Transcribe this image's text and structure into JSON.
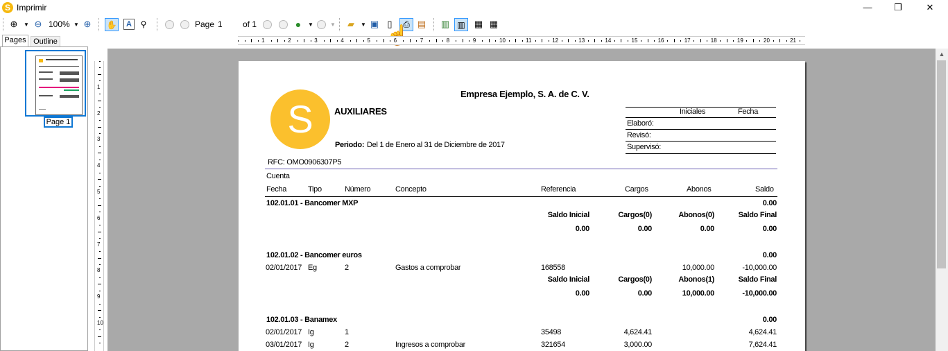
{
  "window": {
    "title": "Imprimir",
    "controls": {
      "minimize": "—",
      "restore": "❐",
      "close": "✕"
    }
  },
  "toolbar": {
    "zoom_value": "100%",
    "page_label": "Page",
    "page_number": "1",
    "of_label": "of 1"
  },
  "tabs": {
    "pages": "Pages",
    "outline": "Outline"
  },
  "thumbnail": {
    "label": "Page 1"
  },
  "ruler": {
    "h_labels": [
      "1",
      "2",
      "3",
      "4",
      "5",
      "6",
      "7",
      "8",
      "9",
      "10",
      "11",
      "12",
      "13",
      "14",
      "15",
      "16",
      "17",
      "18",
      "19",
      "20",
      "21"
    ],
    "v_labels": [
      "1",
      "2",
      "3",
      "4",
      "5",
      "6",
      "7",
      "8",
      "9",
      "10"
    ]
  },
  "report": {
    "company": "Empresa Ejemplo, S. A. de C. V.",
    "logo_letter": "S",
    "logo_color": "#fbc02d",
    "title": "AUXILIARES",
    "period_label": "Periodo:",
    "period_value": "Del 1 de Enero al 31 de Diciembre de 2017",
    "rfc": "RFC: OMO0906307P5",
    "signatures": {
      "initials_header": "Iniciales",
      "date_header": "Fecha",
      "rows": [
        "Elaboró:",
        "Revisó:",
        "Supervisó:"
      ]
    },
    "columns": {
      "cuenta": "Cuenta",
      "fecha": "Fecha",
      "tipo": "Tipo",
      "numero": "Número",
      "concepto": "Concepto",
      "referencia": "Referencia",
      "cargos": "Cargos",
      "abonos": "Abonos",
      "saldo": "Saldo"
    },
    "summary_headers": {
      "saldo_inicial": "Saldo Inicial",
      "cargos": "Cargos(0)",
      "abonos": "Abonos(0)",
      "saldo_final": "Saldo Final"
    },
    "accounts": [
      {
        "title": "102.01.01 - Bancomer MXP",
        "balance": "0.00",
        "summary": {
          "h_saldo_inicial": "Saldo Inicial",
          "h_cargos": "Cargos(0)",
          "h_abonos": "Abonos(0)",
          "h_saldo_final": "Saldo Final",
          "saldo_inicial": "0.00",
          "cargos": "0.00",
          "abonos": "0.00",
          "saldo_final": "0.00"
        }
      },
      {
        "title": "102.01.02 - Bancomer euros",
        "balance": "0.00",
        "rows": [
          {
            "fecha": "02/01/2017",
            "tipo": "Eg",
            "numero": "2",
            "concepto": "Gastos a comprobar",
            "referencia": "168558",
            "cargos": "",
            "abonos": "10,000.00",
            "saldo": "-10,000.00"
          }
        ],
        "summary": {
          "h_saldo_inicial": "Saldo Inicial",
          "h_cargos": "Cargos(0)",
          "h_abonos": "Abonos(1)",
          "h_saldo_final": "Saldo Final",
          "saldo_inicial": "0.00",
          "cargos": "0.00",
          "abonos": "10,000.00",
          "saldo_final": "-10,000.00"
        }
      },
      {
        "title": "102.01.03 - Banamex",
        "balance": "0.00",
        "rows": [
          {
            "fecha": "02/01/2017",
            "tipo": "Ig",
            "numero": "1",
            "concepto": "",
            "referencia": "35498",
            "cargos": "4,624.41",
            "abonos": "",
            "saldo": "4,624.41"
          },
          {
            "fecha": "03/01/2017",
            "tipo": "Ig",
            "numero": "2",
            "concepto": "Ingresos a comprobar",
            "referencia": "321654",
            "cargos": "3,000.00",
            "abonos": "",
            "saldo": "7,624.41"
          }
        ]
      }
    ]
  }
}
